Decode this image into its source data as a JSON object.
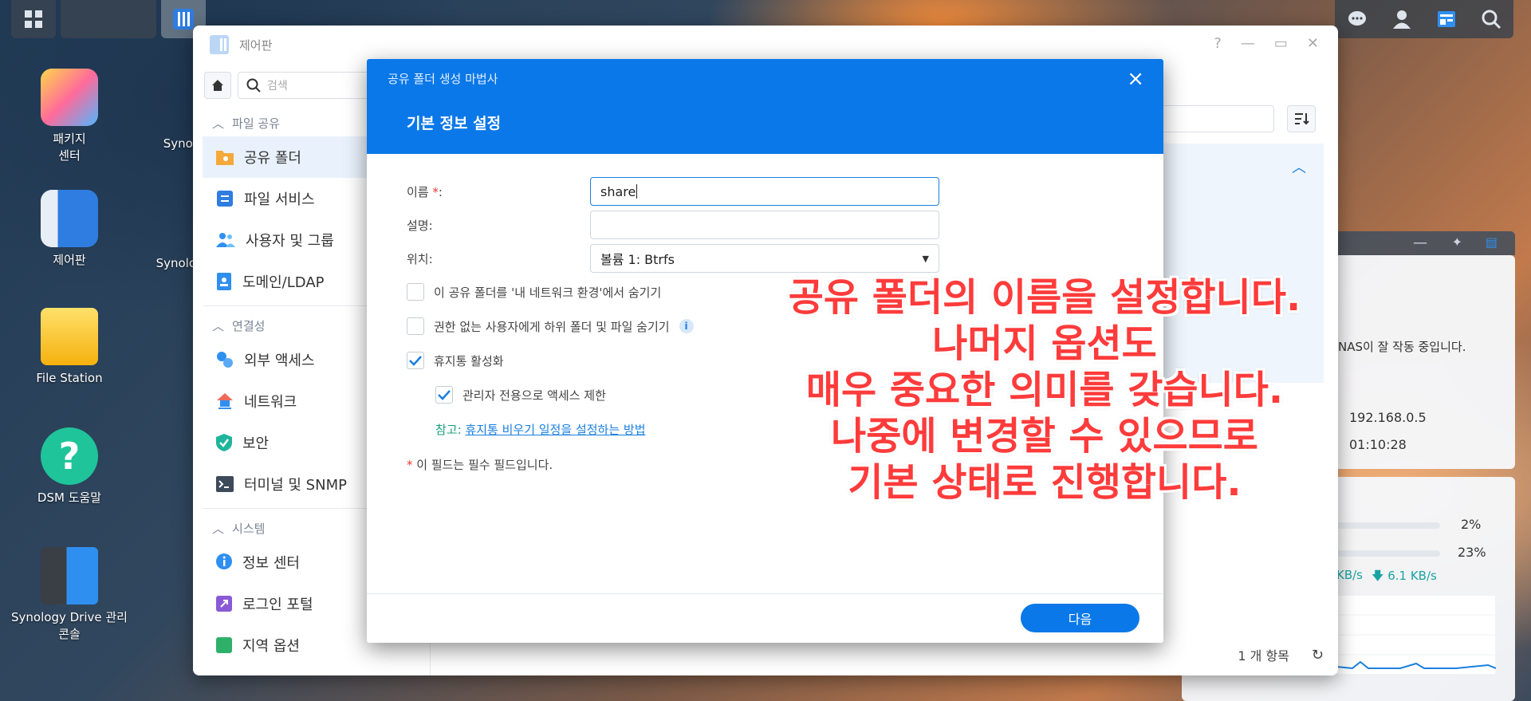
{
  "desktop": {
    "icons": [
      {
        "label_1": "패키지",
        "label_2": "센터",
        "icon": "package-center-icon"
      },
      {
        "label_1": "제어판",
        "label_2": "",
        "icon": "control-panel-icon"
      },
      {
        "label_1": "File Station",
        "label_2": "",
        "icon": "file-station-icon"
      },
      {
        "label_1": "DSM 도움말",
        "label_2": "",
        "icon": "help-icon"
      },
      {
        "label_1": "Synology Drive 관리",
        "label_2": "콘솔",
        "icon": "synology-drive-icon"
      }
    ],
    "partial_labels": [
      "Synol",
      "Synolo"
    ]
  },
  "control_panel": {
    "title": "제어판",
    "search_placeholder": "검색",
    "sections": [
      {
        "header": "파일 공유",
        "items": [
          "공유 폴더",
          "파일 서비스",
          "사용자 및 그룹",
          "도메인/LDAP"
        ]
      },
      {
        "header": "연결성",
        "items": [
          "외부 액세스",
          "네트워크",
          "보안",
          "터미널 및 SNMP"
        ]
      },
      {
        "header": "시스템",
        "items": [
          "정보 센터",
          "로그인 포털",
          "지역 옵션"
        ]
      }
    ],
    "footer_count": "1 개 항목"
  },
  "widget": {
    "status_text": "NAS이 잘 작동 중입니다.",
    "ip": "192.168.0.5",
    "uptime": "01:10:28",
    "cpu": "2%",
    "ram": "23%",
    "upload": "KB/s",
    "download": "6.1 KB/s"
  },
  "wizard": {
    "title": "공유 폴더 생성 마법사",
    "step_title": "기본 정보 설정",
    "name_label": "이름",
    "name_required": "*",
    "name_colon": ":",
    "name_value": "share",
    "desc_label": "설명:",
    "desc_value": "",
    "location_label": "위치:",
    "location_value": "볼륨 1:  Btrfs",
    "options": [
      {
        "label": "이 공유 폴더를 '내 네트워크 환경'에서 숨기기",
        "checked": false
      },
      {
        "label": "권한 없는 사용자에게 하위 폴더 및 파일 숨기기",
        "checked": false
      },
      {
        "label": "휴지통 활성화",
        "checked": true
      },
      {
        "label": "관리자 전용으로 액세스 제한",
        "checked": true
      }
    ],
    "note_prefix": "참고: ",
    "note_link": "휴지통 비우기 일정을 설정하는 방법",
    "required_note_star": "*",
    "required_note": " 이 필드는 필수 필드입니다.",
    "next_button": "다음"
  },
  "overlay": {
    "lines": [
      "공유 폴더의 이름을 설정합니다.",
      "나머지 옵션도",
      "매우 중요한 의미를 갖습니다.",
      "나중에 변경할 수 있으므로",
      "기본 상태로 진행합니다."
    ]
  },
  "colors": {
    "accent": "#0a78e8",
    "overlay_text": "#ff3b3b",
    "note_green": "#1aa37a"
  }
}
